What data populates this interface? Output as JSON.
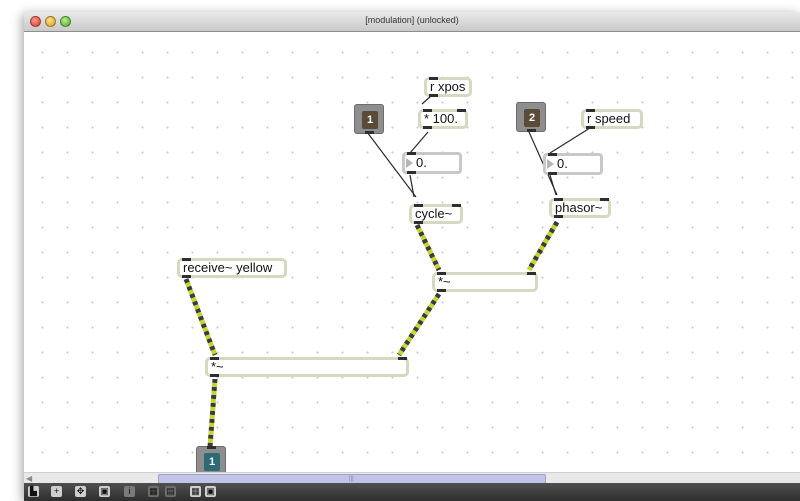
{
  "window": {
    "title": "[modulation] (unlocked)"
  },
  "objects": {
    "r_xpos": "r xpos",
    "mul_100": "* 100.",
    "r_speed": "r speed",
    "num_1": "0.",
    "num_2": "0.",
    "cycle": "cycle~",
    "phasor": "phasor~",
    "receive_yellow": "receive~ yellow",
    "mul_sig_1": "*~",
    "mul_sig_2": "*~"
  },
  "inlets": {
    "in_1": "1",
    "in_2": "2"
  },
  "outlets": {
    "out_1": "1"
  },
  "toolbar": {
    "icons": [
      "lock-icon",
      "new-object-icon",
      "fit-window-icon",
      "presentation-icon",
      "info-icon",
      "grid-icon",
      "snap-icon",
      "patch-cords-icon"
    ]
  },
  "colors": {
    "object_border": "#d4d9bf",
    "signal_cord": "#c5d62a",
    "inlet": "#5a4a37",
    "outlet": "#2c6b74"
  }
}
